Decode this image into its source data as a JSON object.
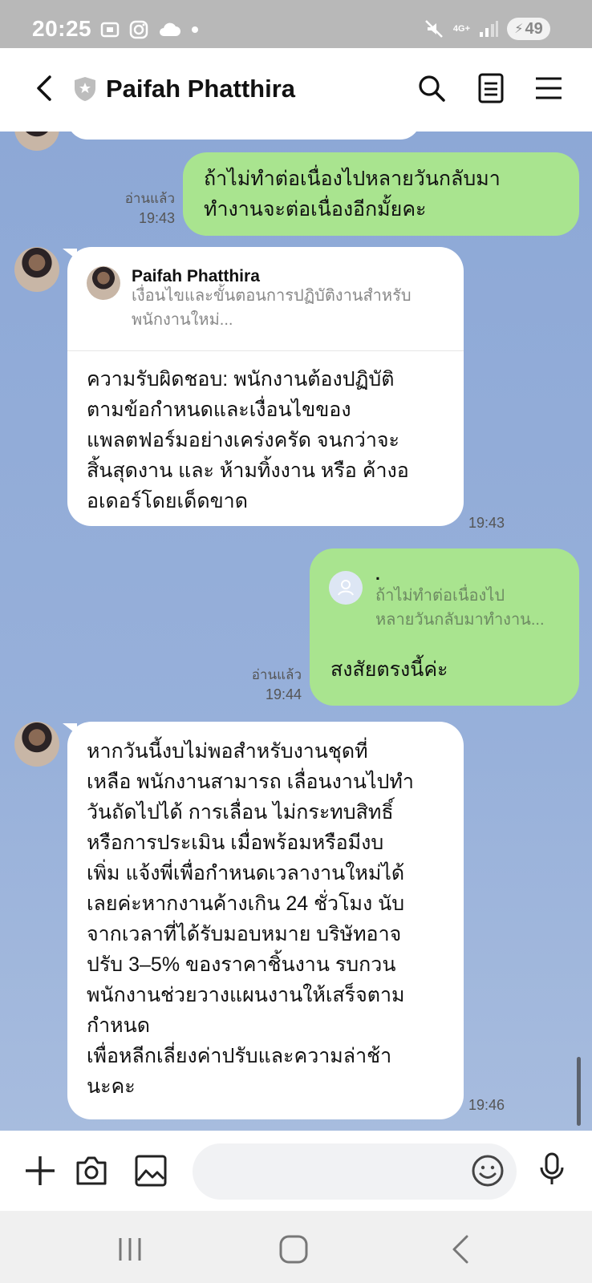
{
  "status_bar": {
    "time": "20:25",
    "network": "4G+",
    "battery": "49"
  },
  "header": {
    "title": "Paifah Phatthira",
    "icons": [
      "back-icon",
      "shield-icon",
      "search-icon",
      "notes-icon",
      "menu-icon"
    ]
  },
  "messages": {
    "m1": {
      "line1": "ถ้าไม่ทำต่อเนื่องไปหลายวันกลับมา",
      "line2": "ทำงานจะต่อเนื่องอีกมั้ยคะ",
      "read": "อ่านแล้ว",
      "time": "19:43"
    },
    "m2": {
      "quote_name": "Paifah Phatthira",
      "quote_line1": "เงื่อนไขและขั้นตอนการปฏิบัติงานสำหรับ",
      "quote_line2": "พนักงานใหม่...",
      "lines": [
        "ความรับผิดชอบ: พนักงานต้องปฏิบัติ",
        "ตามข้อกำหนดและเงื่อนไขของ",
        "แพลตฟอร์มอย่างเคร่งครัด จนกว่าจะ",
        "สิ้นสุดงาน และ ห้ามทิ้งงาน หรือ ค้างอ",
        "อเดอร์โดยเด็ดขาด"
      ],
      "time": "19:43"
    },
    "m3": {
      "quote_name": ".",
      "quote_line1": "ถ้าไม่ทำต่อเนื่องไป",
      "quote_line2": "หลายวันกลับมาทำงาน...",
      "text": "สงสัยตรงนี้ค่ะ",
      "read": "อ่านแล้ว",
      "time": "19:44"
    },
    "m4": {
      "lines": [
        "หากวันนี้งบไม่พอสำหรับงานชุดที่",
        "เหลือ พนักงานสามารถ เลื่อนงานไปทำ",
        "วันถัดไปได้ การเลื่อน ไม่กระทบสิทธิ์",
        "หรือการประเมิน เมื่อพร้อมหรือมีงบ",
        "เพิ่ม แจ้งพี่เพื่อกำหนดเวลางานใหม่ได้",
        "เลยค่ะหากงานค้างเกิน 24 ชั่วโมง นับ",
        "จากเวลาที่ได้รับมอบหมาย บริษัทอาจ",
        "ปรับ 3–5% ของราคาชิ้นงาน รบกวน",
        "พนักงานช่วยวางแผนงานให้เสร็จตาม",
        "กำหนด",
        "เพื่อหลีกเลี่ยงค่าปรับและความล่าช้า",
        "นะคะ"
      ],
      "time": "19:46"
    }
  },
  "input": {
    "placeholder": ""
  },
  "colors": {
    "chat_bg": "#8fa9d6",
    "out_bubble": "#a9e48f",
    "in_bubble": "#ffffff"
  }
}
